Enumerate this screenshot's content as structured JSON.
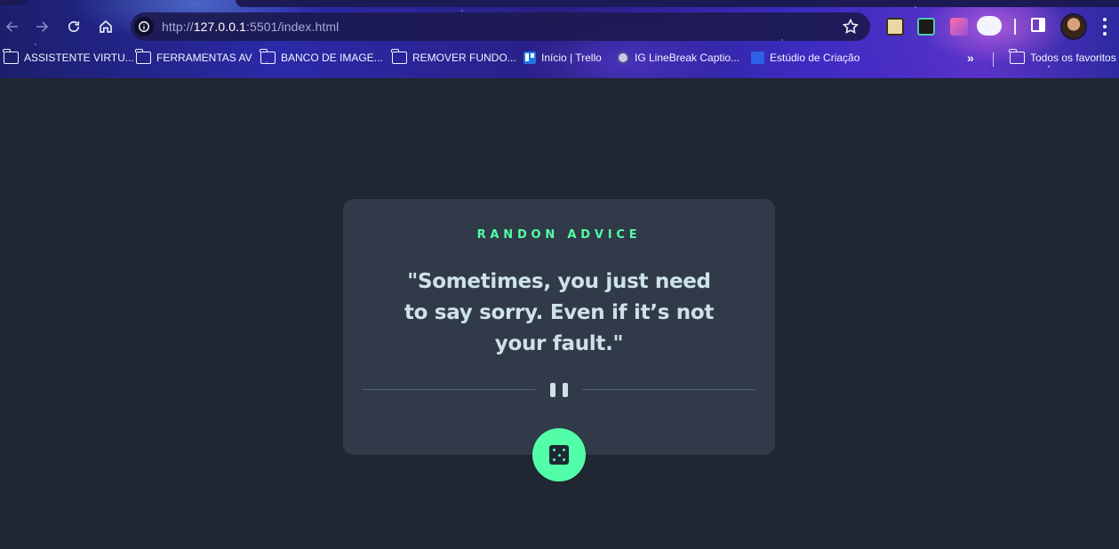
{
  "browser": {
    "url_prefix": "http://",
    "url_host": "127.0.0.1",
    "url_rest": ":5501/index.html",
    "bookmarks": [
      {
        "label": "ASSISTENTE VIRTU...",
        "icon": "folder-icon"
      },
      {
        "label": "FERRAMENTAS AV",
        "icon": "folder-icon"
      },
      {
        "label": "BANCO DE IMAGE...",
        "icon": "folder-icon"
      },
      {
        "label": "REMOVER FUNDO...",
        "icon": "folder-icon"
      },
      {
        "label": "Início | Trello",
        "icon": "trello-icon"
      },
      {
        "label": "IG LineBreak Captio...",
        "icon": "globe-icon"
      },
      {
        "label": "Estúdio de Criação",
        "icon": "studio-icon"
      }
    ],
    "more_bookmarks": "»",
    "all_bookmarks": "Todos os favoritos"
  },
  "app": {
    "title": "RANDON ADVICE",
    "quote": "\"Sometimes, you just need to say sorry. Even if it’s not your fault.\"",
    "accent_color": "#52ffa8",
    "card_color": "#313a48",
    "background_color": "#202632"
  }
}
